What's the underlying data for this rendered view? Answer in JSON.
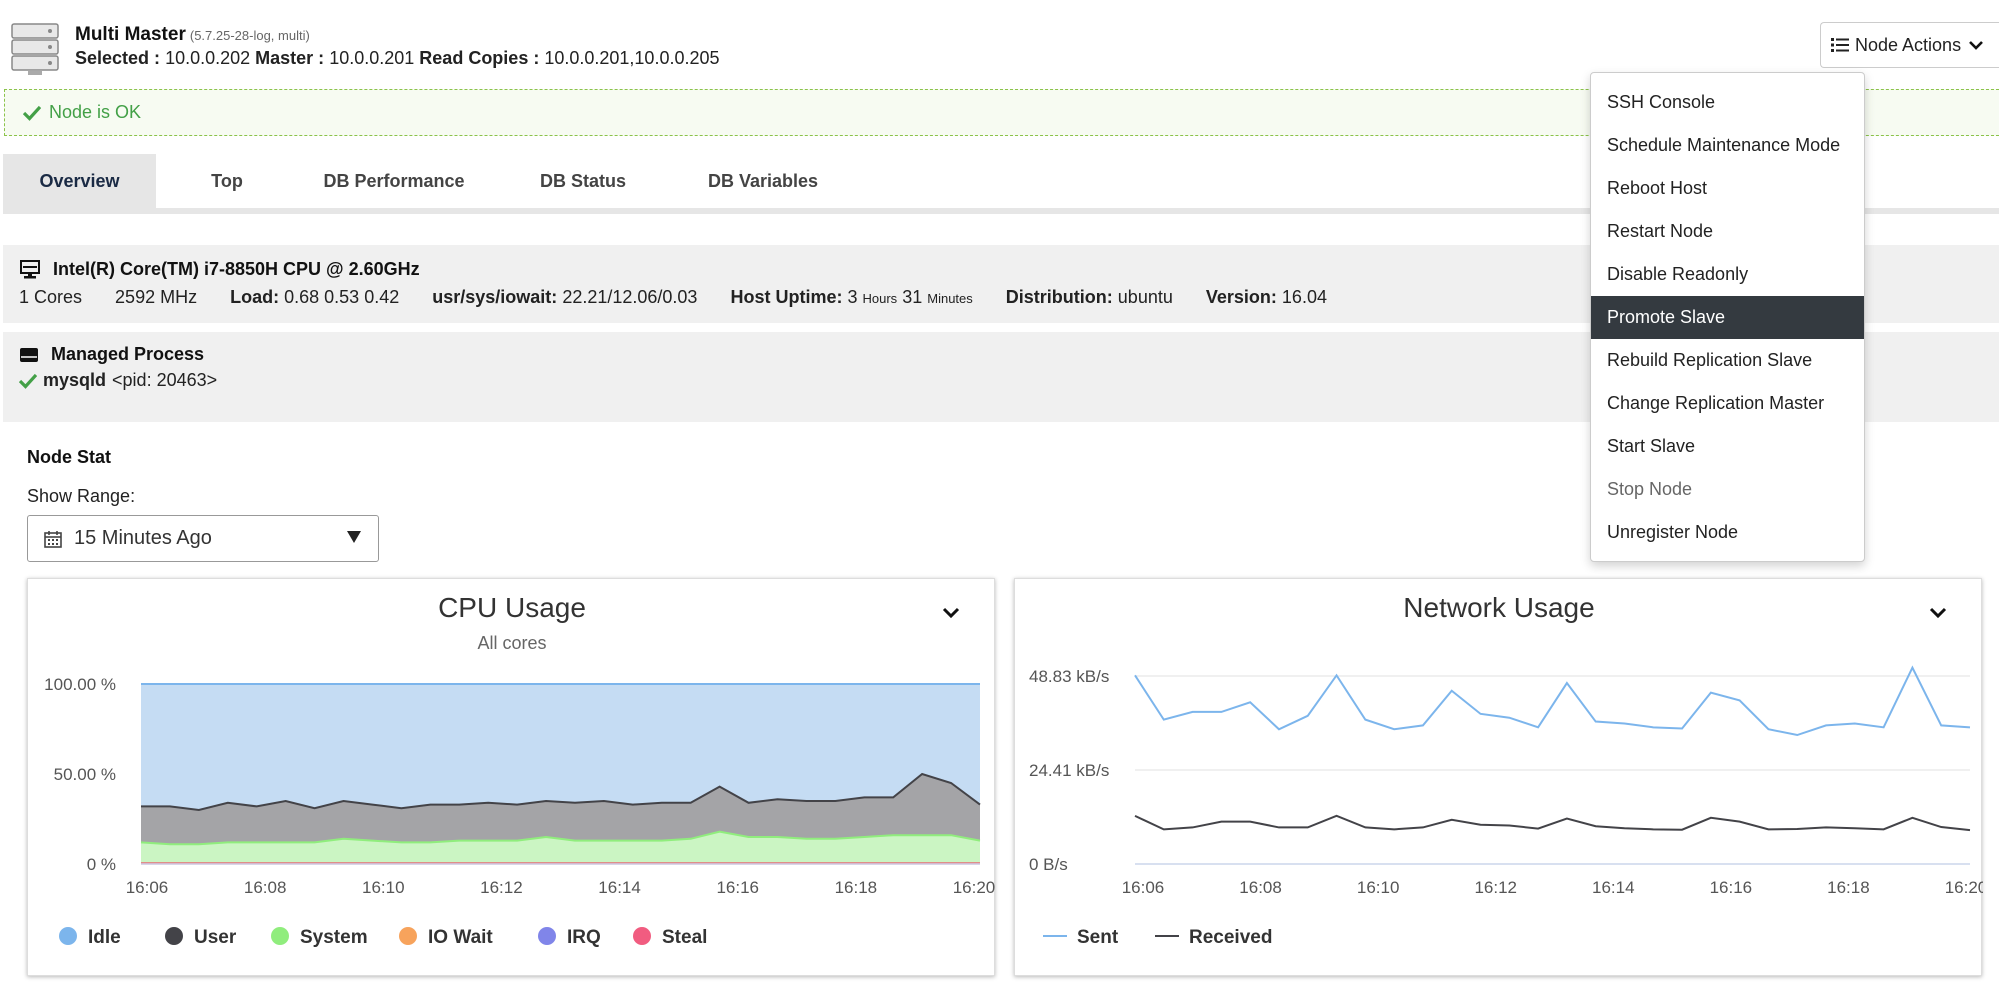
{
  "header": {
    "title": "Multi Master",
    "version": "(5.7.25-28-log, multi)",
    "selected_label": "Selected :",
    "selected_value": "10.0.0.202",
    "master_label": "Master :",
    "master_value": "10.0.0.201",
    "read_copies_label": "Read Copies :",
    "read_copies_value": "10.0.0.201,10.0.0.205",
    "node_actions_label": "Node Actions"
  },
  "status": {
    "text": "Node is OK",
    "color": "#43a047"
  },
  "tabs": [
    {
      "label": "Overview",
      "active": true
    },
    {
      "label": "Top"
    },
    {
      "label": "DB Performance"
    },
    {
      "label": "DB Status"
    },
    {
      "label": "DB Variables"
    }
  ],
  "cpu_info": {
    "model": "Intel(R) Core(TM) i7-8850H CPU @ 2.60GHz",
    "cores": "1 Cores",
    "mhz": "2592 MHz",
    "load_label": "Load:",
    "load_value": "0.68 0.53 0.42",
    "iowait_label": "usr/sys/iowait:",
    "iowait_value": "22.21/12.06/0.03",
    "uptime_label": "Host Uptime:",
    "uptime_hours": "3",
    "uptime_hours_unit": "Hours",
    "uptime_minutes": "31",
    "uptime_minutes_unit": "Minutes",
    "distribution_label": "Distribution:",
    "distribution_value": "ubuntu",
    "version_label": "Version:",
    "version_value": "16.04"
  },
  "process": {
    "title": "Managed Process",
    "name": "mysqld",
    "pid": "<pid: 20463>"
  },
  "node_stat": {
    "title": "Node Stat",
    "range_label": "Show Range:",
    "range_value": "15 Minutes Ago"
  },
  "dropdown": {
    "items": [
      {
        "label": "SSH Console"
      },
      {
        "label": "Schedule Maintenance Mode"
      },
      {
        "label": "Reboot Host"
      },
      {
        "label": "Restart Node"
      },
      {
        "label": "Disable Readonly"
      },
      {
        "label": "Promote Slave",
        "highlighted": true
      },
      {
        "label": "Rebuild Replication Slave"
      },
      {
        "label": "Change Replication Master"
      },
      {
        "label": "Start Slave"
      },
      {
        "label": "Stop Node",
        "muted": true
      },
      {
        "label": "Unregister Node"
      }
    ]
  },
  "chart_data": [
    {
      "type": "area",
      "title": "CPU Usage",
      "subtitle": "All cores",
      "x_ticks": [
        "16:06",
        "16:08",
        "16:10",
        "16:12",
        "16:14",
        "16:16",
        "16:18",
        "16:20"
      ],
      "y_ticks": [
        "100.00 %",
        "50.00 %",
        "0 %"
      ],
      "ylim": [
        0,
        100
      ],
      "stacked": true,
      "legend_position": "bottom",
      "series": [
        {
          "name": "Idle",
          "color": "#7cb5ec",
          "fill": "#c5dcf3",
          "values": [
            100,
            100,
            100,
            100,
            100,
            100,
            100,
            100,
            100,
            100,
            100,
            100,
            100,
            100,
            100,
            100,
            100,
            100,
            100,
            100,
            100,
            100,
            100,
            100,
            100,
            100,
            100,
            100,
            100,
            100
          ]
        },
        {
          "name": "User",
          "color": "#434348",
          "fill": "#a4a4a7",
          "values": [
            32,
            32,
            30,
            34,
            32,
            35,
            31,
            35,
            33,
            31,
            33,
            33,
            34,
            33,
            35,
            34,
            35,
            33,
            34,
            34,
            43,
            34,
            36,
            35,
            35,
            37,
            37,
            50,
            45,
            33
          ]
        },
        {
          "name": "System",
          "color": "#90ed7d",
          "fill": "#cbf5c3",
          "values": [
            12,
            11,
            11,
            12,
            12,
            12,
            12,
            14,
            13,
            12,
            12,
            13,
            13,
            13,
            15,
            13,
            13,
            13,
            13,
            14,
            18,
            15,
            15,
            14,
            14,
            15,
            16,
            16,
            16,
            13
          ]
        },
        {
          "name": "IO Wait",
          "color": "#f7a35c",
          "values": [
            0.5,
            0.5,
            0.5,
            0.5,
            0.5,
            0.5,
            0.5,
            0.5,
            0.5,
            0.5,
            0.5,
            0.5,
            0.5,
            0.5,
            0.5,
            0.5,
            0.5,
            0.5,
            0.5,
            0.5,
            0.5,
            0.5,
            0.5,
            0.5,
            0.5,
            0.5,
            0.5,
            0.5,
            0.5,
            0.5
          ]
        },
        {
          "name": "IRQ",
          "color": "#8085e9",
          "values": [
            0.3,
            0.3,
            0.3,
            0.3,
            0.3,
            0.3,
            0.3,
            0.3,
            0.3,
            0.3,
            0.3,
            0.3,
            0.3,
            0.3,
            0.3,
            0.3,
            0.3,
            0.3,
            0.3,
            0.3,
            0.3,
            0.3,
            0.3,
            0.3,
            0.3,
            0.3,
            0.3,
            0.3,
            0.3,
            0.3
          ]
        },
        {
          "name": "Steal",
          "color": "#f15c80",
          "values": [
            0.2,
            0.2,
            0.2,
            0.2,
            0.2,
            0.2,
            0.2,
            0.2,
            0.2,
            0.2,
            0.2,
            0.2,
            0.2,
            0.2,
            0.2,
            0.2,
            0.2,
            0.2,
            0.2,
            0.2,
            0.2,
            0.2,
            0.2,
            0.2,
            0.2,
            0.2,
            0.2,
            0.2,
            0.2,
            0.2
          ]
        }
      ]
    },
    {
      "type": "line",
      "title": "Network Usage",
      "x_ticks": [
        "16:06",
        "16:08",
        "16:10",
        "16:12",
        "16:14",
        "16:16",
        "16:18",
        "16:20"
      ],
      "y_ticks": [
        "48.83 kB/s",
        "24.41 kB/s",
        "0 B/s"
      ],
      "ylim": [
        0,
        48.83
      ],
      "legend_position": "bottom",
      "series": [
        {
          "name": "Sent",
          "color": "#7cb5ec",
          "values": [
            49,
            37.5,
            39.5,
            39.5,
            42,
            35,
            38.5,
            49,
            37.5,
            35,
            36,
            45,
            39,
            38,
            35.5,
            47,
            37,
            36.5,
            35.5,
            35.2,
            44.5,
            42.5,
            35,
            33.5,
            36,
            36.5,
            35.5,
            51,
            36,
            35.5
          ]
        },
        {
          "name": "Received",
          "color": "#434348",
          "values": [
            12.5,
            9,
            9.5,
            11,
            11,
            9.5,
            9.5,
            12.5,
            9.5,
            9,
            9.5,
            11.5,
            10.2,
            10,
            9.2,
            11.8,
            9.8,
            9.3,
            9,
            8.9,
            12,
            11,
            9,
            9.1,
            9.5,
            9.3,
            9,
            12,
            9.6,
            8.8
          ]
        }
      ]
    }
  ]
}
